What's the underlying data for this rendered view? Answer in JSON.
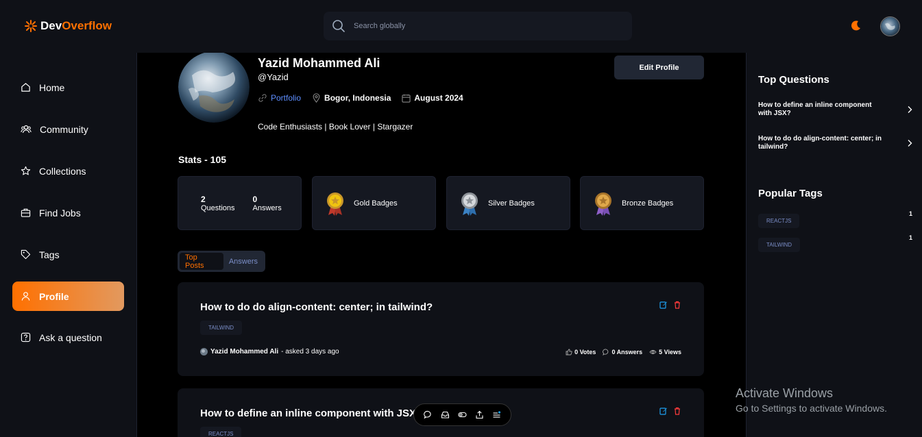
{
  "app": {
    "logo_part1": "Dev",
    "logo_part2": "Overflow"
  },
  "search": {
    "placeholder": "Search globally"
  },
  "sidebar": {
    "items": [
      {
        "label": "Home",
        "icon": "home-icon"
      },
      {
        "label": "Community",
        "icon": "users-icon"
      },
      {
        "label": "Collections",
        "icon": "star-icon"
      },
      {
        "label": "Find Jobs",
        "icon": "suitcase-icon"
      },
      {
        "label": "Tags",
        "icon": "tag-icon"
      },
      {
        "label": "Profile",
        "icon": "user-icon",
        "active": true
      },
      {
        "label": "Ask a question",
        "icon": "question-icon"
      }
    ]
  },
  "profile": {
    "name": "Yazid Mohammed Ali",
    "username": "@Yazid",
    "portfolio_label": "Portfolio",
    "location": "Bogor, Indonesia",
    "joined": "August 2024",
    "bio": "Code Enthusiasts | Book Lover | Stargazer",
    "edit_label": "Edit Profile"
  },
  "stats": {
    "title": "Stats - 105",
    "questions_count": "2",
    "questions_label": "Questions",
    "answers_count": "0",
    "answers_label": "Answers",
    "badges": [
      {
        "label": "Gold Badges",
        "color": "#e2a93b"
      },
      {
        "label": "Silver Badges",
        "color": "#a8a9ad"
      },
      {
        "label": "Bronze Badges",
        "color": "#c8963e"
      }
    ]
  },
  "tabs": {
    "top_posts": "Top Posts",
    "answers": "Answers"
  },
  "posts": [
    {
      "title": "How to do do align-content: center; in tailwind?",
      "tag": "TAILWIND",
      "author": "Yazid Mohammed Ali",
      "asked": "- asked 3 days ago",
      "votes": "0 Votes",
      "answers": "0 Answers",
      "views": "5 Views"
    },
    {
      "title": "How to define an inline component with JSX",
      "tag": "REACTJS"
    }
  ],
  "right_sidebar": {
    "top_questions_title": "Top Questions",
    "top_questions": [
      "How to define an inline component with JSX?",
      "How to do do align-content: center; in tailwind?"
    ],
    "popular_tags_title": "Popular Tags",
    "popular_tags": [
      {
        "name": "REACTJS",
        "count": "1"
      },
      {
        "name": "TAILWIND",
        "count": "1"
      }
    ]
  },
  "watermark": {
    "line1": "Activate Windows",
    "line2": "Go to Settings to activate Windows."
  },
  "colors": {
    "accent": "#ff7000",
    "link": "#5e8eff",
    "edit_icon": "#1da1f2",
    "delete_icon": "#ff3b3b"
  }
}
